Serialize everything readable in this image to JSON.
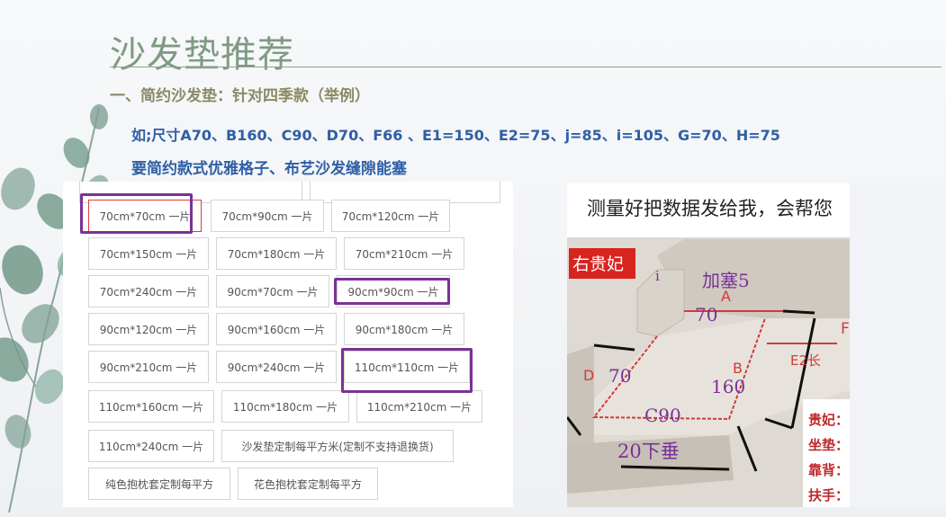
{
  "title": "沙发垫推荐",
  "subtitle": "一、简约沙发垫：针对四季款（举例）",
  "line1": "如;尺寸A70、B160、C90、D70、F66 、E1=150、E2=75、j=85、i=105、G=70、H=75",
  "line2": "要简约款式优雅格子、布艺沙发缝隙能塞",
  "options": [
    "70cm*70cm 一片",
    "70cm*90cm 一片",
    "70cm*120cm 一片",
    "70cm*150cm 一片",
    "70cm*180cm 一片",
    "70cm*210cm 一片",
    "70cm*240cm 一片",
    "90cm*70cm 一片",
    "90cm*90cm 一片",
    "90cm*120cm 一片",
    "90cm*160cm 一片",
    "90cm*180cm 一片",
    "90cm*210cm 一片",
    "90cm*240cm 一片",
    "110cm*110cm 一片",
    "110cm*160cm 一片",
    "110cm*180cm 一片",
    "110cm*210cm 一片",
    "110cm*240cm 一片",
    "沙发垫定制每平方米(定制不支持退换货)",
    "纯色抱枕套定制每平方",
    "花色抱枕套定制每平方"
  ],
  "photo": {
    "header": "测量好把数据发给我，会帮您",
    "side_tag": "右贵妃",
    "labels": {
      "jiasai": "加塞5",
      "a": "A",
      "a_val": "70",
      "i": "i",
      "b": "B",
      "b_val": "160",
      "c": "C90",
      "d": "D",
      "d_val": "70",
      "e2": "E2长",
      "f": "F",
      "drop": "20下垂"
    },
    "legend": [
      "贵妃：",
      "坐垫：",
      "靠背：",
      "扶手："
    ]
  },
  "colors": {
    "title": "#7f9a82",
    "subtitle": "#8a8a64",
    "body_text": "#2f5fa6",
    "highlight": "#7a3296",
    "selected_border": "#e23a3a"
  }
}
